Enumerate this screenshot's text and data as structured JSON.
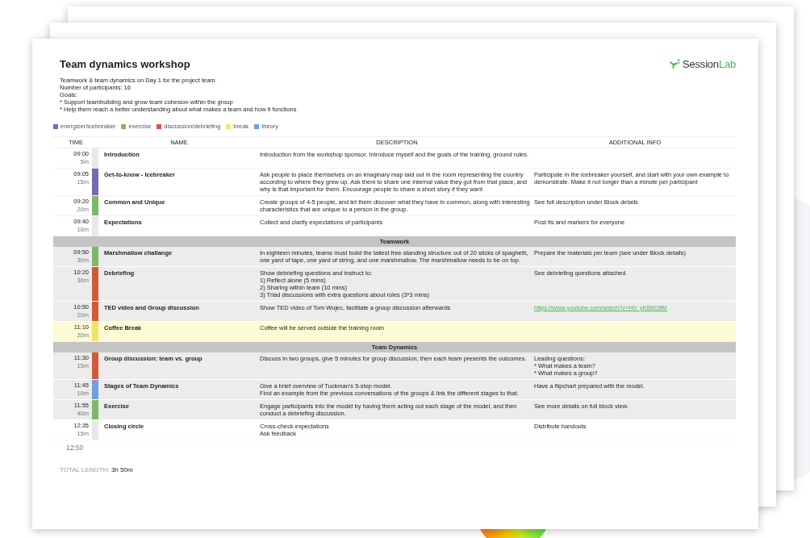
{
  "document": {
    "title": "Team dynamics workshop",
    "intro": "Teamwork & team dynamics on Day 1 for the project team.\nNumber of participants: 16\nGoals:\n* Support teambuilding and grow team cohesion within the group\n* Help them reach a better understanding about what makes a team and how it functions",
    "logo": {
      "text": "Session",
      "accent": "Lab"
    },
    "legend": [
      {
        "label": "energizer/icebreaker",
        "color": "#7b68b0"
      },
      {
        "label": "exercise",
        "color": "#7cb867"
      },
      {
        "label": "discussion/debriefing",
        "color": "#d4583a"
      },
      {
        "label": "break",
        "color": "#f2e36b"
      },
      {
        "label": "theory",
        "color": "#6fa0da"
      }
    ],
    "columns": [
      "TIME",
      "NAME",
      "DESCRIPTION",
      "ADDITIONAL INFO"
    ],
    "rows": [
      {
        "kind": "block",
        "time": "09:00",
        "duration": "5m",
        "name": "Introduction",
        "description": "Introduction from the workshop sponsor. Introduce myself and the goals of the training, ground rules.",
        "color": "#e8e8e8",
        "shaded": false
      },
      {
        "kind": "block",
        "time": "09:05",
        "duration": "15m",
        "name": "Get-to-know - Icebreaker",
        "description": "Ask people to place themselves on an imaginary map laid out in the room representing the country according to where they grew up.  Ask them to share one internal value they got from that place, and why is that important for them. Encourage people to share a short story if they want",
        "info": "Participate in the icebreaker yourself, and start with your own example to demonstrate. Make it not longer than a minute per participant",
        "color": "#7b68b0",
        "shaded": false
      },
      {
        "kind": "block",
        "time": "09:20",
        "duration": "20m",
        "name": "Common and Unique",
        "description": "Create groups of 4-5 people, and let them discover what they have in common, along with interesting characteristics that are unique to a person in the group.",
        "info": "See full description under Block details",
        "color": "#7cb867",
        "shaded": false
      },
      {
        "kind": "block",
        "time": "09:40",
        "duration": "10m",
        "name": "Expectations",
        "description": "Collect and clarify expectations of participants",
        "info": "Post its and markers for everyone",
        "color": "#e8e8e8",
        "shaded": false
      },
      {
        "kind": "section",
        "name": "Teamwork"
      },
      {
        "kind": "block",
        "time": "09:50",
        "duration": "30m",
        "name": "Marshmallow challange",
        "description": "In eighteen minutes, teams must build the tallest free-standing structure out of 20 sticks of spaghetti, one yard of tape, one yard of string, and one marshmallow. The marshmallow needs to be on top.",
        "info": "Prepare the materials per team (see under Block details)",
        "color": "#7cb867",
        "shaded": true
      },
      {
        "kind": "block",
        "time": "10:20",
        "duration": "30m",
        "name": "Debriefing",
        "description": "Show debriefing questions and instruct to:\n1) Reflect alone (5 mins)\n2) Sharing within team (10 mins)\n3) Triad discussions with extra questions about roles (3*3 mins)",
        "info": "See debriefing questions attached",
        "color": "#d4583a",
        "shaded": true
      },
      {
        "kind": "block",
        "time": "10:50",
        "duration": "20m",
        "name": "TED video and Group discussion",
        "description": "Show TED video of Tom Wujec, facilitate a group discussion afterwards",
        "info": "https://www.youtube.com/watch?v=H0_yKBitO8M",
        "info_link": true,
        "color": "#d4583a",
        "shaded": true
      },
      {
        "kind": "break",
        "time": "11:10",
        "duration": "20m",
        "name": "Coffee Break",
        "description": "Coffee will be served outside the training room",
        "color": "#f2e36b",
        "shaded": false
      },
      {
        "kind": "section",
        "name": "Team Dynamics"
      },
      {
        "kind": "block",
        "time": "11:30",
        "duration": "15m",
        "name": "Group discussion: team vs. group",
        "description": "Discuss in two groups, give 5 minutes for group discussion, then each team presents the outcomes.",
        "info": "Leading questions:\n* What makes a team?\n* What makes a group?",
        "color": "#d4583a",
        "shaded": true
      },
      {
        "kind": "block",
        "time": "11:45",
        "duration": "10m",
        "name": "Stages of Team Dynamics",
        "description": "Give a brief overview of Tuckman's 5-step model.\nFind an example from the previous conversations of the groups & link the different stages to that.",
        "info": "Have a flipchart prepared with the model.",
        "color": "#6fa0da",
        "shaded": true
      },
      {
        "kind": "block",
        "time": "11:55",
        "duration": "40m",
        "name": "Exercise",
        "description": "Engage participants into the model by having them acting out each stage of the model, and then conduct a debriefing discussion.",
        "info": "See more details on full block view.",
        "color": "#7cb867",
        "shaded": true
      },
      {
        "kind": "block",
        "time": "12:35",
        "duration": "15m",
        "name": "Closing circle",
        "description": "Cross-check expectations\nAsk feedback",
        "info": "Distribute handouts",
        "color": "#e8e8e8",
        "shaded": false
      }
    ],
    "end_time": "12:50",
    "total": {
      "label": "TOTAL LENGTH:",
      "value": "3h 50m"
    }
  }
}
